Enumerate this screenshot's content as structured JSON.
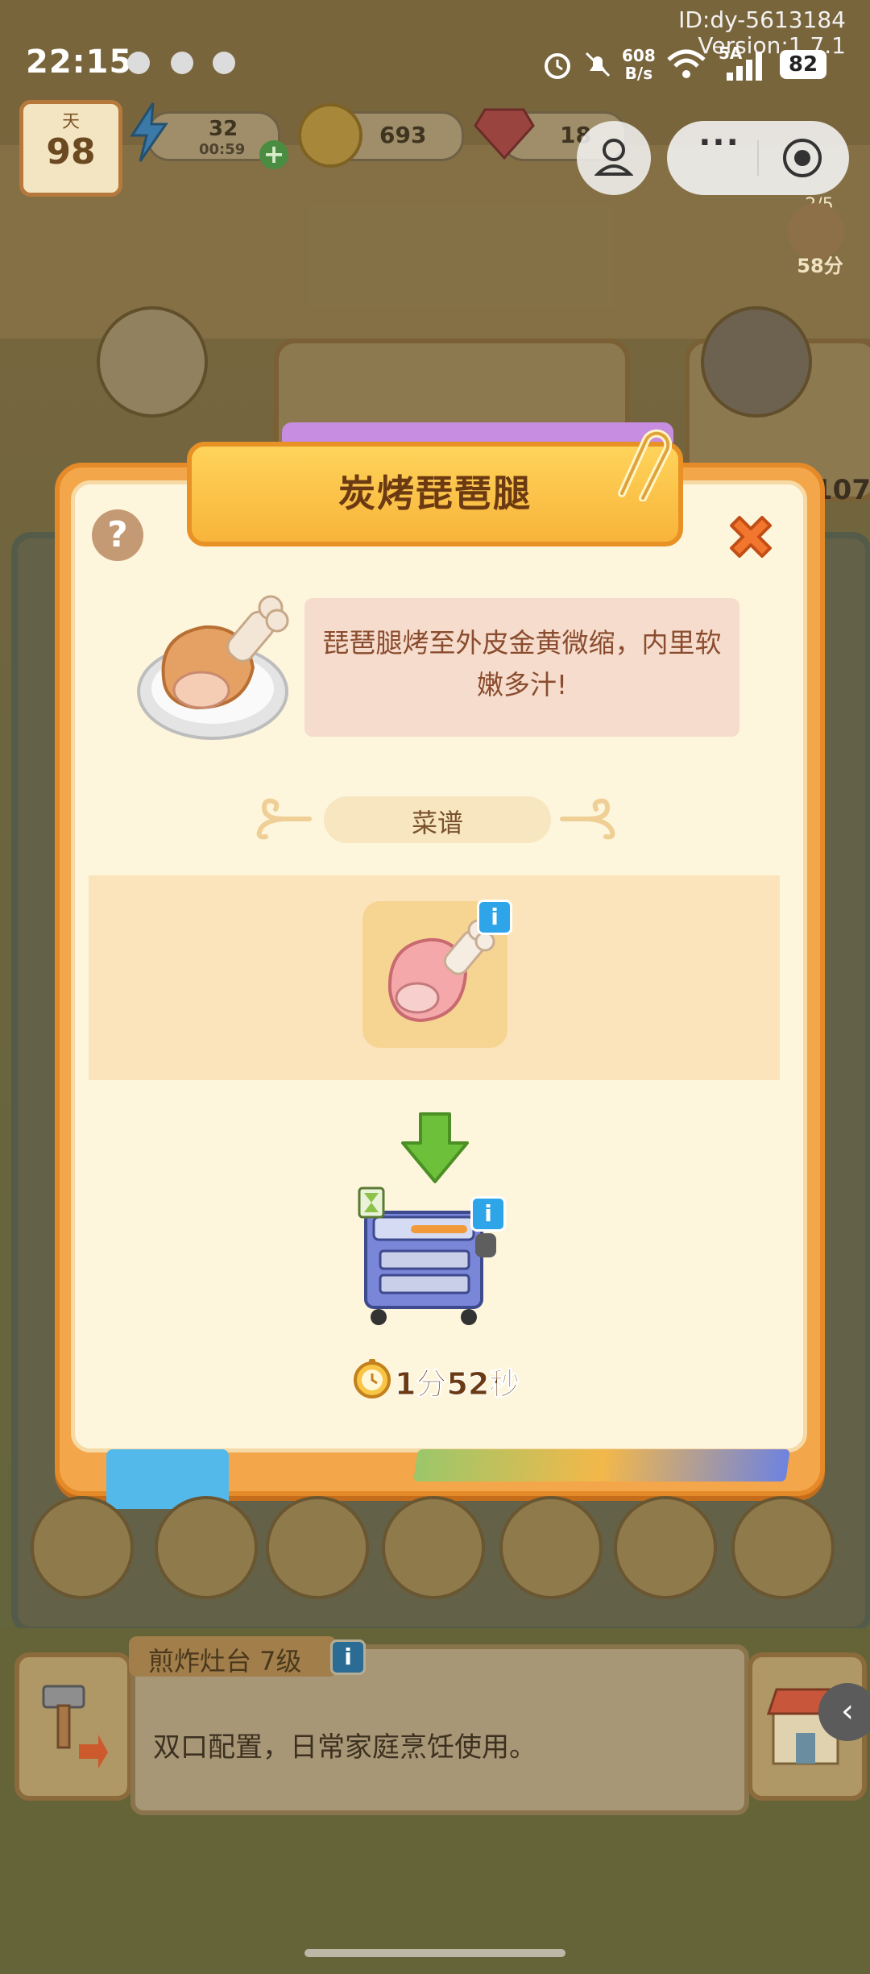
{
  "status_bar": {
    "time": "22:15",
    "net_speed_value": "608",
    "net_speed_unit": "B/s",
    "signal_label": "5A",
    "battery": "82",
    "id_text": "ID:dy-5613184",
    "version_text": "Version:1.7.1"
  },
  "resources": {
    "day_label": "天",
    "day_value": "98",
    "energy_value": "32",
    "energy_timer": "00:59",
    "coins": "693",
    "gems": "18"
  },
  "side_badge": {
    "progress": "2/5",
    "time": "58分"
  },
  "side_counter": "107",
  "modal": {
    "title": "炭烤琵琶腿",
    "help_symbol": "?",
    "description": "琵琶腿烤至外皮金黄微缩，内里软嫩多汁!",
    "recipe_label": "菜谱",
    "info_symbol": "i",
    "cook_time": "1分52秒"
  },
  "info_panel": {
    "name": "煎炸灶台 7级",
    "info_symbol": "i",
    "description": "双口配置，日常家庭烹饪使用。"
  },
  "colors": {
    "modal_orange": "#f3a64a",
    "modal_cream": "#fdf6dc",
    "title_text": "#6b3a12",
    "desc_text": "#8a4c2e",
    "info_blue": "#2ea5e8",
    "arrow_green": "#6cc03a"
  }
}
